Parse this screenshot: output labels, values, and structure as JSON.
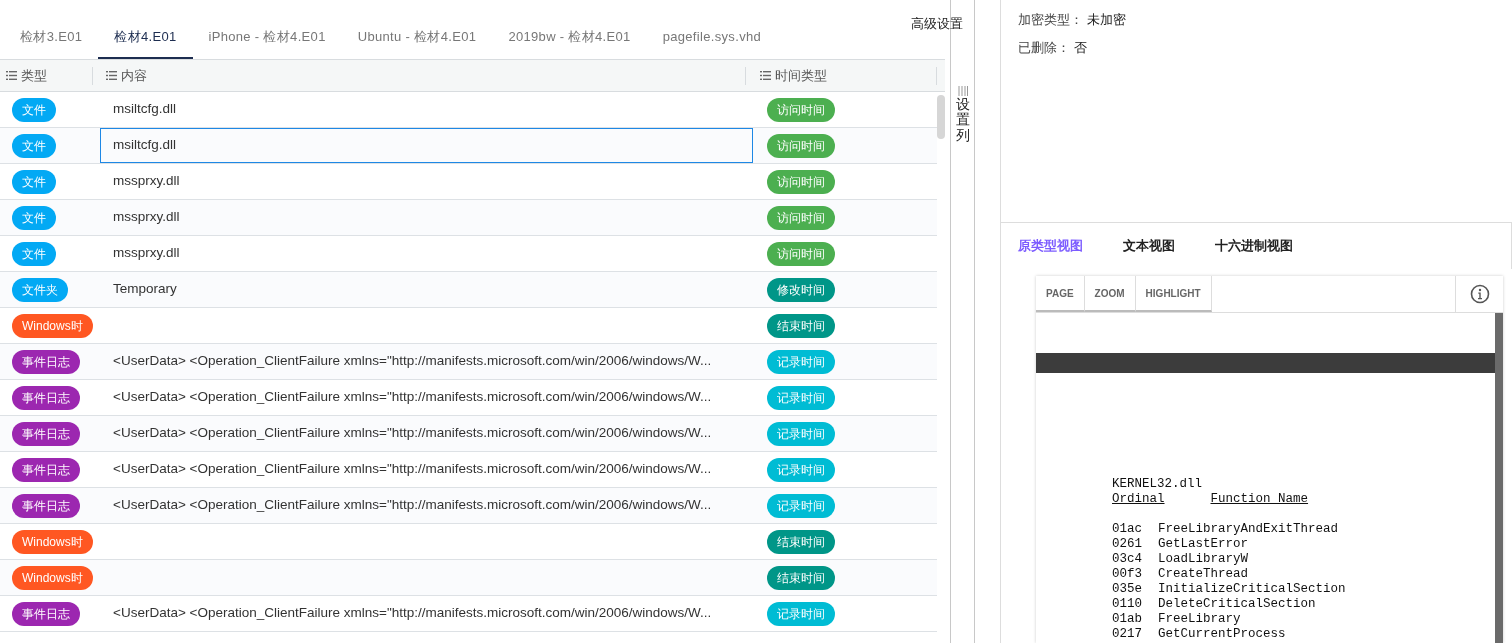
{
  "tabs": [
    {
      "label": "检材3.E01",
      "selected": false
    },
    {
      "label": "检材4.E01",
      "selected": true
    },
    {
      "label": "iPhone - 检材4.E01",
      "selected": false
    },
    {
      "label": "Ubuntu - 检材4.E01",
      "selected": false
    },
    {
      "label": "2019bw - 检材4.E01",
      "selected": false
    },
    {
      "label": "pagefile.sys.vhd",
      "selected": false
    }
  ],
  "advanced_settings": "高级设置",
  "table": {
    "columns": [
      "类型",
      "内容",
      "时间类型"
    ],
    "rows": [
      {
        "type": {
          "text": "文件",
          "color": "#03a9f4"
        },
        "content": "msiltcfg.dll",
        "time_type": {
          "text": "访问时间",
          "color": "#4caf50"
        },
        "selected": false
      },
      {
        "type": {
          "text": "文件",
          "color": "#03a9f4"
        },
        "content": "msiltcfg.dll",
        "time_type": {
          "text": "访问时间",
          "color": "#4caf50"
        },
        "selected": true
      },
      {
        "type": {
          "text": "文件",
          "color": "#03a9f4"
        },
        "content": "mssprxy.dll",
        "time_type": {
          "text": "访问时间",
          "color": "#4caf50"
        },
        "selected": false
      },
      {
        "type": {
          "text": "文件",
          "color": "#03a9f4"
        },
        "content": "mssprxy.dll",
        "time_type": {
          "text": "访问时间",
          "color": "#4caf50"
        },
        "selected": false
      },
      {
        "type": {
          "text": "文件",
          "color": "#03a9f4"
        },
        "content": "mssprxy.dll",
        "time_type": {
          "text": "访问时间",
          "color": "#4caf50"
        },
        "selected": false
      },
      {
        "type": {
          "text": "文件夹",
          "color": "#03a9f4"
        },
        "content": "Temporary",
        "time_type": {
          "text": "修改时间",
          "color": "#009688"
        },
        "selected": false
      },
      {
        "type": {
          "text": "Windows时",
          "color": "#ff5722"
        },
        "time_type": {
          "text": "结束时间",
          "color": "#009688"
        },
        "selected": false
      },
      {
        "type": {
          "text": "事件日志",
          "color": "#9c27b0"
        },
        "content": "<UserData> <Operation_ClientFailure xmlns=\"http://manifests.microsoft.com/win/2006/windows/W...",
        "time_type": {
          "text": "记录时间",
          "color": "#00bcd4"
        },
        "selected": false
      },
      {
        "type": {
          "text": "事件日志",
          "color": "#9c27b0"
        },
        "content": "<UserData> <Operation_ClientFailure xmlns=\"http://manifests.microsoft.com/win/2006/windows/W...",
        "time_type": {
          "text": "记录时间",
          "color": "#00bcd4"
        },
        "selected": false
      },
      {
        "type": {
          "text": "事件日志",
          "color": "#9c27b0"
        },
        "content": "<UserData> <Operation_ClientFailure xmlns=\"http://manifests.microsoft.com/win/2006/windows/W...",
        "time_type": {
          "text": "记录时间",
          "color": "#00bcd4"
        },
        "selected": false
      },
      {
        "type": {
          "text": "事件日志",
          "color": "#9c27b0"
        },
        "content": "<UserData> <Operation_ClientFailure xmlns=\"http://manifests.microsoft.com/win/2006/windows/W...",
        "time_type": {
          "text": "记录时间",
          "color": "#00bcd4"
        },
        "selected": false
      },
      {
        "type": {
          "text": "事件日志",
          "color": "#9c27b0"
        },
        "content": "<UserData> <Operation_ClientFailure xmlns=\"http://manifests.microsoft.com/win/2006/windows/W...",
        "time_type": {
          "text": "记录时间",
          "color": "#00bcd4"
        },
        "selected": false
      },
      {
        "type": {
          "text": "Windows时",
          "color": "#ff5722"
        },
        "time_type": {
          "text": "结束时间",
          "color": "#009688"
        },
        "selected": false
      },
      {
        "type": {
          "text": "Windows时",
          "color": "#ff5722"
        },
        "time_type": {
          "text": "结束时间",
          "color": "#009688"
        },
        "selected": false
      },
      {
        "type": {
          "text": "事件日志",
          "color": "#9c27b0"
        },
        "content": "<UserData> <Operation_ClientFailure xmlns=\"http://manifests.microsoft.com/win/2006/windows/W...",
        "time_type": {
          "text": "记录时间",
          "color": "#00bcd4"
        },
        "selected": false
      }
    ]
  },
  "column_settings": "设置列",
  "details": [
    {
      "label": "加密类型：",
      "value": "未加密"
    },
    {
      "label": "已删除：",
      "value": "否"
    }
  ],
  "view_tabs": [
    {
      "label": "原类型视图",
      "selected": true
    },
    {
      "label": "文本视图",
      "selected": false
    },
    {
      "label": "十六进制视图",
      "selected": false
    }
  ],
  "viewer": {
    "toolbar": [
      "PAGE",
      "ZOOM",
      "HIGHLIGHT"
    ],
    "document": {
      "title": "KERNEL32.dll",
      "headers": [
        "Ordinal",
        "Function Name"
      ],
      "entries": [
        {
          "ordinal": "01ac",
          "name": "FreeLibraryAndExitThread"
        },
        {
          "ordinal": "0261",
          "name": "GetLastError"
        },
        {
          "ordinal": "03c4",
          "name": "LoadLibraryW"
        },
        {
          "ordinal": "00f3",
          "name": "CreateThread"
        },
        {
          "ordinal": "035e",
          "name": "InitializeCriticalSection"
        },
        {
          "ordinal": "0110",
          "name": "DeleteCriticalSection"
        },
        {
          "ordinal": "01ab",
          "name": "FreeLibrary"
        },
        {
          "ordinal": "0217",
          "name": "GetCurrentProcess"
        }
      ]
    }
  }
}
